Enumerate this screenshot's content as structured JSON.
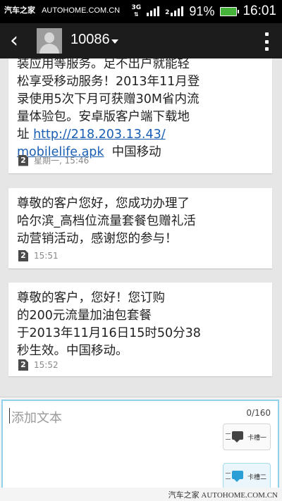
{
  "watermark": {
    "brand": "汽车之家",
    "site": "AUTOHOME.COM.CN",
    "bottom": "汽车之家 AUTOHOME.COM.CN"
  },
  "status_bar": {
    "network": "3G",
    "sim2_tag": "2",
    "battery": "91%",
    "time": "16:01"
  },
  "action_bar": {
    "contact": "10086",
    "icons": {
      "back": "back-arrow-icon",
      "avatar": "person-avatar-icon",
      "menu": "overflow-menu-icon"
    }
  },
  "messages": [
    {
      "lines": [
        "装应用等服务。足不出户就能轻",
        "松享受移动服务！2013年11月登",
        "录使用5次下月可获赠30M省内流",
        "量体验包。安卓版客户端下载地"
      ],
      "link_prefix": "址 ",
      "link_1": "http://218.203.13.43/",
      "link_2": "mobilelife.apk",
      "link_suffix": "  中国移动",
      "sim": "2",
      "time": "星期一, 15:46"
    },
    {
      "lines": [
        "尊敬的客户您好，您成功办理了",
        "哈尔滨_高档位流量套餐包赠礼活",
        "动营销活动，感谢您的参与！"
      ],
      "sim": "2",
      "time": "15:51"
    },
    {
      "lines": [
        "尊敬的客户，您好！您订购",
        "的200元流量加油包套餐",
        "于2013年11月16日15时50分38",
        "秒生效。中国移动。"
      ],
      "sim": "2",
      "time": "15:52"
    }
  ],
  "composer": {
    "placeholder": "添加文本",
    "counter": "0/160",
    "send_sim1": "卡槽一",
    "send_sim2": "卡槽二"
  }
}
